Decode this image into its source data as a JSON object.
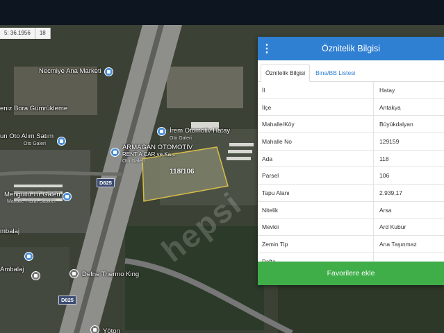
{
  "map": {
    "coordinate_readout": [
      "5: 36.1956",
      "18"
    ],
    "parcel_label": "118/106",
    "watermark": "hepsi",
    "road_shields": [
      "D825",
      "D825"
    ],
    "pois": [
      {
        "name": "Necmiye Ana Marketi"
      },
      {
        "name": "eniz Bora Gümrükleme"
      },
      {
        "name": "un Oto Alım Satım",
        "sub": "Oto Galeri"
      },
      {
        "name": "İrem Otomotiv Hatay",
        "sub": "Oto Galeri"
      },
      {
        "name": "ARMAĞAN OTOMOTİV",
        "line2": "RENT A CAR ve Ka...",
        "sub": "Oto Galeri"
      },
      {
        "name": "Mengüllü Tır Galeri",
        "sub": "Mahalle Pazar Sabitler"
      },
      {
        "name": "mbalaj"
      },
      {
        "name": "Ambalaj"
      },
      {
        "name": "Defne Thermo King"
      },
      {
        "name": "Yöton"
      }
    ]
  },
  "panel": {
    "title": "Öznitelik Bilgisi",
    "menu_icon": "vertical-dots-icon",
    "tabs": [
      {
        "label": "Öznitelik Bilgisi",
        "active": true
      },
      {
        "label": "Bina/BB Listesi",
        "active": false
      }
    ],
    "rows": [
      {
        "key": "İl",
        "value": "Hatay"
      },
      {
        "key": "İlçe",
        "value": "Antakya"
      },
      {
        "key": "Mahalle/Köy",
        "value": "Büyükdalyan"
      },
      {
        "key": "Mahalle No",
        "value": "129159"
      },
      {
        "key": "Ada",
        "value": "118"
      },
      {
        "key": "Parsel",
        "value": "106"
      },
      {
        "key": "Tapu Alanı",
        "value": "2.939,17"
      },
      {
        "key": "Nitelik",
        "value": "Arsa"
      },
      {
        "key": "Mevkii",
        "value": "Ard Kubur"
      },
      {
        "key": "Zemin Tip",
        "value": "Ana Taşınmaz"
      },
      {
        "key": "Pafta",
        "value": "-"
      }
    ],
    "button_label": "Favorilere ekle"
  },
  "colors": {
    "header": "#2f7fd3",
    "button": "#3fae49",
    "parcel_outline": "#e8c94a"
  }
}
